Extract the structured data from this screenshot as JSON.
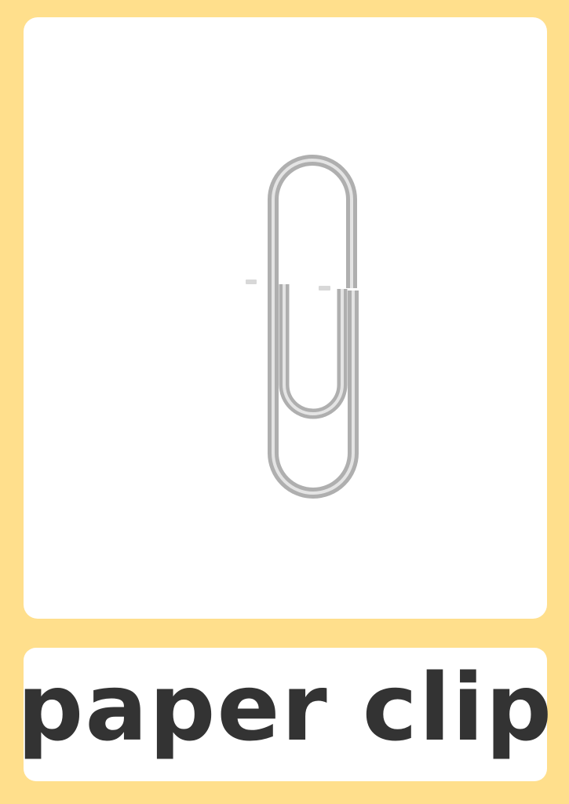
{
  "card": {
    "word": "paper clip",
    "picture_icon": "paper-clip-icon"
  },
  "colors": {
    "frame": "#FFDF8C",
    "panel": "#FFFFFF",
    "text": "#333333",
    "clip_metal": "#B5B5B5",
    "clip_highlight": "#E6E6E6"
  }
}
